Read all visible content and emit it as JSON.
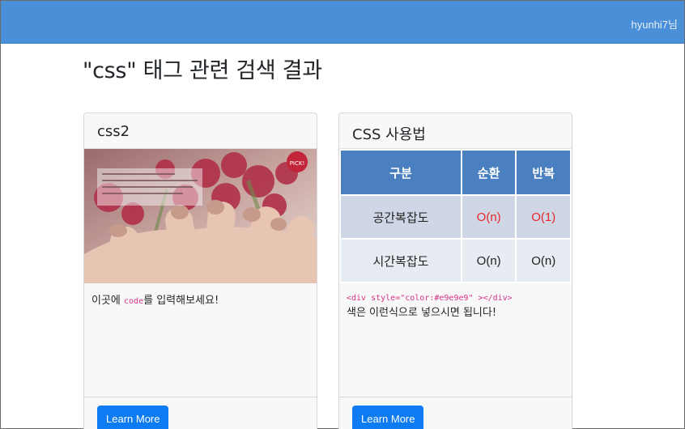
{
  "nav": {
    "user": "hyunhi7님",
    "brand_color": "#4a90d9"
  },
  "page": {
    "title": "\"css\" 태그 관련 검색 결과"
  },
  "cards": [
    {
      "title": "css2",
      "image_overlay_lines": [
        "",
        "",
        "",
        ""
      ],
      "image_badge": "PICK!",
      "body_before": "이곳에 ",
      "body_code": "code",
      "body_after": "를 입력해보세요!",
      "button": "Learn More"
    },
    {
      "title": "CSS 사용법",
      "table": {
        "headers": [
          "구분",
          "순환",
          "반복"
        ],
        "rows": [
          [
            "공간복잡도",
            "O(n)",
            "O(1)"
          ],
          [
            "시간복잡도",
            "O(n)",
            "O(n)"
          ]
        ]
      },
      "body_code": "<div style=\"color:#e9e9e9\" ></div>",
      "body_text": "색은 이런식으로 넣으시면 됩니다!",
      "button": "Learn More"
    }
  ]
}
